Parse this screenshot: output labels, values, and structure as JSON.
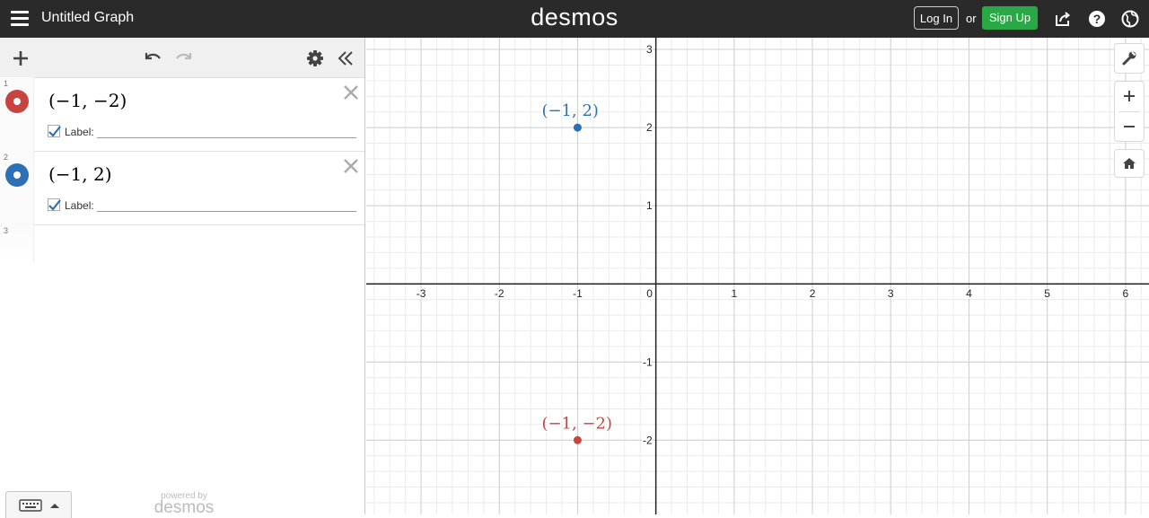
{
  "header": {
    "title": "Untitled Graph",
    "brand": "desmos",
    "login_label": "Log In",
    "or_label": "or",
    "signup_label": "Sign Up",
    "signup_color": "#2aa845"
  },
  "expressions": [
    {
      "index": "1",
      "latex": "(−1, −2)",
      "color": "#c74440",
      "label_caption": "Label:",
      "label_checked": true,
      "label_value": ""
    },
    {
      "index": "2",
      "latex": "(−1, 2)",
      "color": "#2d70b3",
      "label_caption": "Label:",
      "label_checked": true,
      "label_value": ""
    },
    {
      "index": "3",
      "latex": "",
      "color": "",
      "label_caption": "",
      "label_checked": false,
      "label_value": ""
    }
  ],
  "footer": {
    "powered_by": "powered by",
    "brand": "desmos"
  },
  "graph": {
    "x_range": [
      -3.7,
      6.3
    ],
    "y_range": [
      -2.95,
      3.15
    ],
    "major_step": 1,
    "minor_step": 0.2,
    "x_ticks": [
      "-3",
      "-2",
      "-1",
      "0",
      "1",
      "2",
      "3",
      "4",
      "5",
      "6"
    ],
    "y_ticks": [
      "3",
      "2",
      "1",
      "-1",
      "-2"
    ],
    "points": [
      {
        "x": -1,
        "y": -2,
        "label": "(−1, −2)",
        "color": "#c74440"
      },
      {
        "x": -1,
        "y": 2,
        "label": "(−1, 2)",
        "color": "#2d70b3"
      }
    ]
  },
  "icons": {
    "menu": "hamburger-icon",
    "share": "share-icon",
    "help": "help-icon",
    "language": "globe-icon",
    "add": "plus-icon",
    "undo": "undo-icon",
    "redo": "redo-icon",
    "settings": "gear-icon",
    "collapse": "double-chevron-left-icon",
    "wrench": "wrench-icon",
    "zoom_in": "zoom-in-icon",
    "zoom_out": "zoom-out-icon",
    "home": "home-icon",
    "keyboard": "keyboard-icon"
  }
}
